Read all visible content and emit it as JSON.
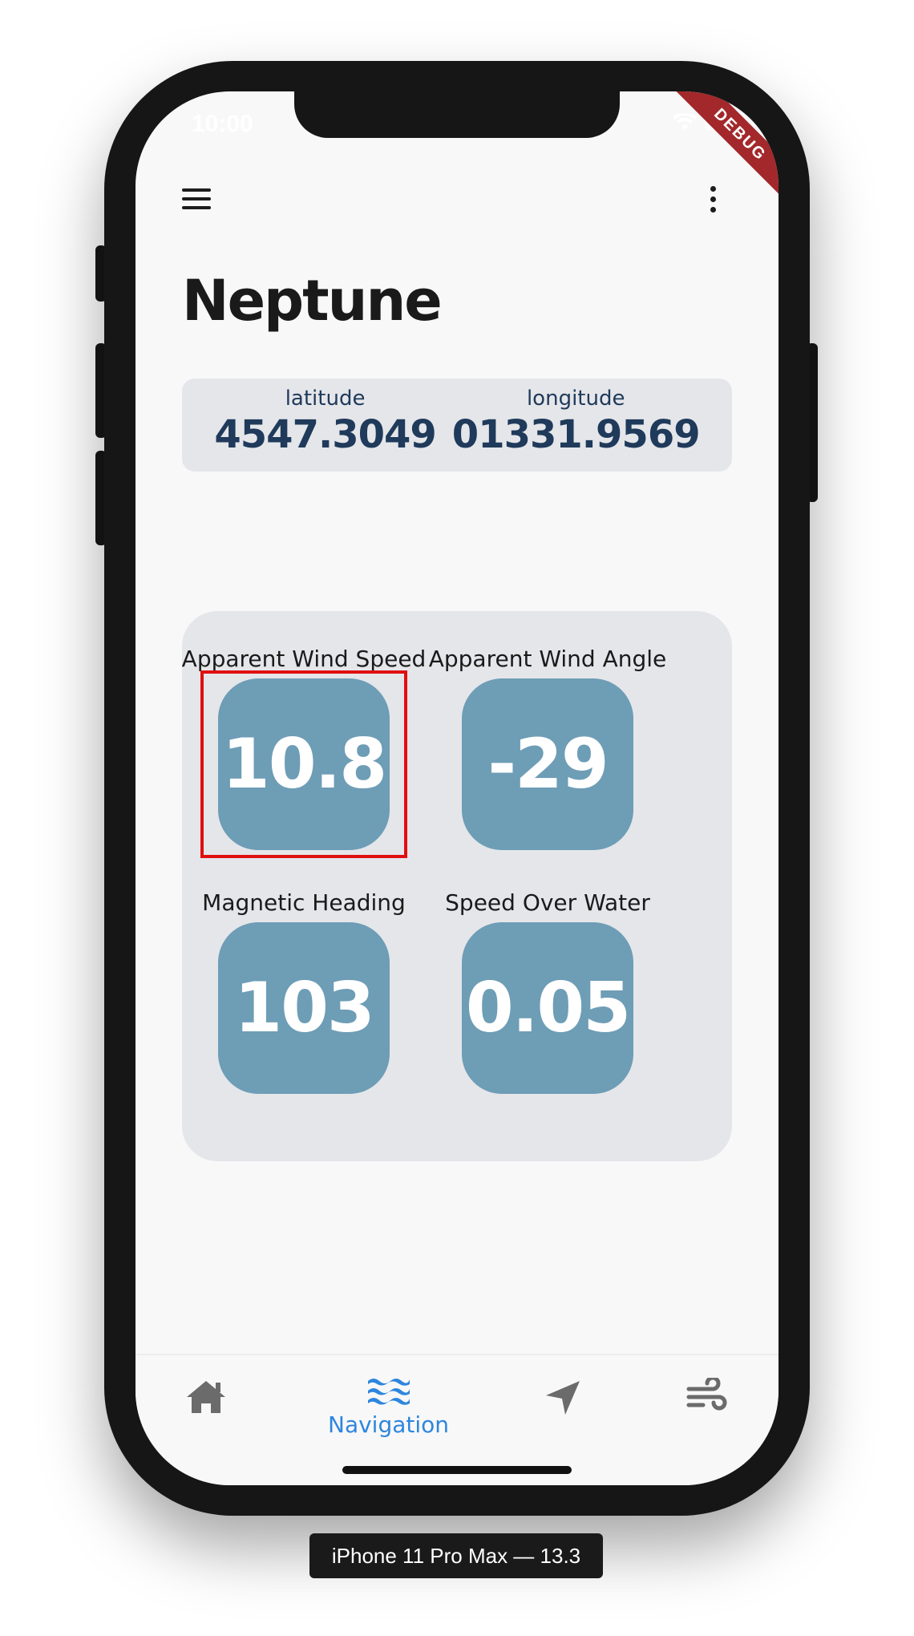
{
  "status_bar": {
    "time": "10:00"
  },
  "debug_banner": "DEBUG",
  "header": {
    "menu_icon": "hamburger-menu-icon",
    "more_icon": "more-vertical-icon"
  },
  "page_title": "Neptune",
  "position": {
    "latitude": {
      "label": "latitude",
      "value": "4547.3049"
    },
    "longitude": {
      "label": "longitude",
      "value": "01331.9569"
    }
  },
  "gauges": [
    {
      "label": "Apparent Wind Speed",
      "value": "10.8"
    },
    {
      "label": "Apparent Wind Angle",
      "value": "-29"
    },
    {
      "label": "Magnetic Heading",
      "value": "103"
    },
    {
      "label": "Speed Over Water",
      "value": "0.05"
    }
  ],
  "bottom_nav": {
    "items": [
      {
        "icon": "home-icon",
        "label": "",
        "active": false
      },
      {
        "icon": "waves-icon",
        "label": "Navigation",
        "active": true
      },
      {
        "icon": "navigation-arrow-icon",
        "label": "",
        "active": false
      },
      {
        "icon": "wind-icon",
        "label": "",
        "active": false
      }
    ]
  },
  "device_label": "iPhone 11 Pro Max — 13.3",
  "colors": {
    "accent": "#2e86de",
    "tile": "#6e9db6",
    "card": "#e5e6ea",
    "coord_text": "#1f3a5a",
    "highlight": "#e01010"
  }
}
